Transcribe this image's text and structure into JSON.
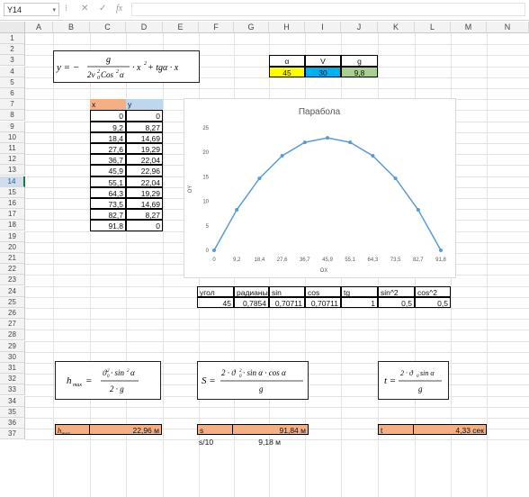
{
  "formula_bar": {
    "cell_ref": "Y14",
    "fx_label": "fx"
  },
  "columns": [
    "A",
    "B",
    "C",
    "D",
    "E",
    "F",
    "G",
    "H",
    "I",
    "J",
    "K",
    "L",
    "M",
    "N"
  ],
  "rows": [
    "1",
    "2",
    "3",
    "4",
    "5",
    "6",
    "7",
    "8",
    "9",
    "10",
    "11",
    "12",
    "13",
    "14",
    "15",
    "16",
    "17",
    "18",
    "19",
    "20",
    "21",
    "22",
    "23",
    "24",
    "25",
    "26",
    "27",
    "28",
    "29",
    "30",
    "31",
    "32",
    "33",
    "34",
    "35",
    "36",
    "37"
  ],
  "selected_row": "14",
  "params": {
    "headers": [
      "α",
      "V",
      "g"
    ],
    "values": [
      "45",
      "30",
      "9,8"
    ],
    "colors": {
      "alpha": "#ffff00",
      "v": "#00b0f0",
      "g": "#a9d08e"
    }
  },
  "xy_table": {
    "header_x": "x",
    "header_y": "y",
    "header_colors": {
      "x": "#f4b084",
      "y": "#bdd7ee"
    },
    "rows": [
      [
        "0",
        "0"
      ],
      [
        "9,2",
        "8,27"
      ],
      [
        "18,4",
        "14,69"
      ],
      [
        "27,6",
        "19,29"
      ],
      [
        "36,7",
        "22,04"
      ],
      [
        "45,9",
        "22,96"
      ],
      [
        "55,1",
        "22,04"
      ],
      [
        "64,3",
        "19,29"
      ],
      [
        "73,5",
        "14,69"
      ],
      [
        "82,7",
        "8,27"
      ],
      [
        "91,8",
        "0"
      ]
    ]
  },
  "angles_table": {
    "headers": [
      "угол",
      "радианы",
      "sin",
      "cos",
      "tg",
      "sin^2",
      "cos^2"
    ],
    "values": [
      "45",
      "0,7854",
      "0,70711",
      "0,70711",
      "1",
      "0,5",
      "0,5"
    ]
  },
  "results": {
    "hmax_label": "h",
    "hmax_sub": "max",
    "hmax_value": "22,96 м",
    "s_label": "s",
    "s_value": "91,84 м",
    "s10_label": "s/10",
    "s10_value": "9,18 м",
    "t_label": "t",
    "t_value": "4,33 сек",
    "result_color": "#f4b084"
  },
  "formulas": {
    "main": "y = − g / (2v₀²Cos²α) · x² + tgα · x",
    "hmax": "h_max = ϑ₀² · sin²α / (2 · g)",
    "s": "S = 2 · ϑ₀² · sin α · cos α / g",
    "t": "t = 2 · ϑ₀ sin α / g"
  },
  "chart_data": {
    "type": "line",
    "title": "Парабола",
    "xlabel": "OX",
    "ylabel": "OY",
    "categories": [
      "0",
      "9,2",
      "18,4",
      "27,6",
      "36,7",
      "45,9",
      "55,1",
      "64,3",
      "73,5",
      "82,7",
      "91,8"
    ],
    "series": [
      {
        "values": [
          0,
          8.27,
          14.69,
          19.29,
          22.04,
          22.96,
          22.04,
          19.29,
          14.69,
          8.27,
          0
        ]
      }
    ],
    "ylim": [
      0,
      25
    ],
    "yticks": [
      "0",
      "5",
      "10",
      "15",
      "20",
      "25"
    ],
    "color": "#5b9bd5",
    "grid": false,
    "legend": "none"
  }
}
